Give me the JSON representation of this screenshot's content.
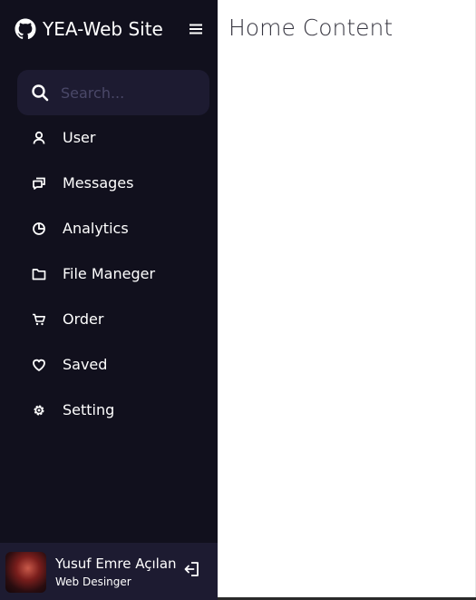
{
  "sidebar": {
    "logo": {
      "text": "YEA-Web Site",
      "icon": "github-icon"
    },
    "menu_icon": "hamburger-menu-icon",
    "search": {
      "placeholder": "Search...",
      "value": "",
      "icon": "search-icon"
    },
    "items": [
      {
        "label": "User",
        "icon": "user-icon"
      },
      {
        "label": "Messages",
        "icon": "chat-icon"
      },
      {
        "label": "Analytics",
        "icon": "pie-chart-icon"
      },
      {
        "label": "File Maneger",
        "icon": "folder-icon"
      },
      {
        "label": "Order",
        "icon": "cart-icon"
      },
      {
        "label": "Saved",
        "icon": "heart-icon"
      },
      {
        "label": "Setting",
        "icon": "gear-icon"
      }
    ],
    "profile": {
      "name": "Yusuf Emre Açılan",
      "job": "Web Desinger",
      "logout_icon": "logout-icon"
    }
  },
  "main": {
    "title": "Home Content"
  },
  "colors": {
    "sidebar_bg": "#11101d",
    "sidebar_accent": "#1d1b31",
    "text": "#ffffff"
  }
}
